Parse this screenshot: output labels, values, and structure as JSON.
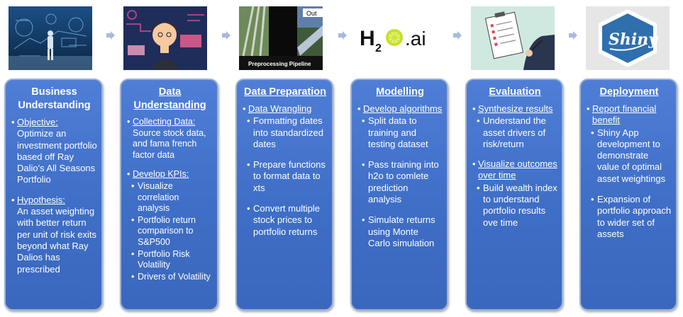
{
  "images": {
    "deployment_logo_text": "Shiny",
    "h2o_logo_text": "H2O.ai",
    "pipeline_caption": "Preprocessing Pipeline",
    "pipeline_out_label": "Out"
  },
  "stages": [
    {
      "title": "Business Understanding",
      "sections": [
        {
          "heading": "Objective:",
          "text": "Optimize an investment portfolio based off Ray Dalio's All Seasons Portfolio"
        },
        {
          "heading": "Hypothesis:",
          "text": "An asset weighting with better return per unit of risk exits beyond what Ray Dalios has prescribed"
        }
      ]
    },
    {
      "title": "Data Understanding",
      "sections": [
        {
          "heading": "Collecting Data:",
          "text": "Source stock data, and fama french factor data"
        },
        {
          "heading": "Develop KPIs:",
          "items": [
            "Visualize correlation analysis",
            "Portfolio return comparison  to S&P500",
            "Portfolio Risk Volatility",
            "Drivers of Volatility"
          ]
        }
      ]
    },
    {
      "title": "Data Preparation",
      "sections": [
        {
          "heading": "Data Wrangling",
          "items": [
            "Formatting dates into standardized dates",
            "Prepare functions to format data to xts",
            "Convert multiple stock prices to portfolio returns"
          ]
        }
      ]
    },
    {
      "title": "Modelling",
      "sections": [
        {
          "heading": "Develop algorithms",
          "items": [
            "Split data to training and testing dataset",
            "Pass training into h2o to comlete prediction analysis",
            "Simulate returns using Monte Carlo simulation"
          ]
        }
      ]
    },
    {
      "title": "Evaluation",
      "sections": [
        {
          "heading": "Synthesize results",
          "items": [
            "Understand the asset drivers of risk/return"
          ]
        },
        {
          "heading": "Visualize outcomes over time",
          "items": [
            "Build wealth index to understand portfolio results ove time"
          ]
        }
      ]
    },
    {
      "title": "Deployment",
      "sections": [
        {
          "heading": "Report financial benefit",
          "items": [
            "Shiny App development to demonstrate value of optimal asset weightings",
            "Expansion of portfolio approach to wider set of assets"
          ]
        }
      ]
    }
  ]
}
